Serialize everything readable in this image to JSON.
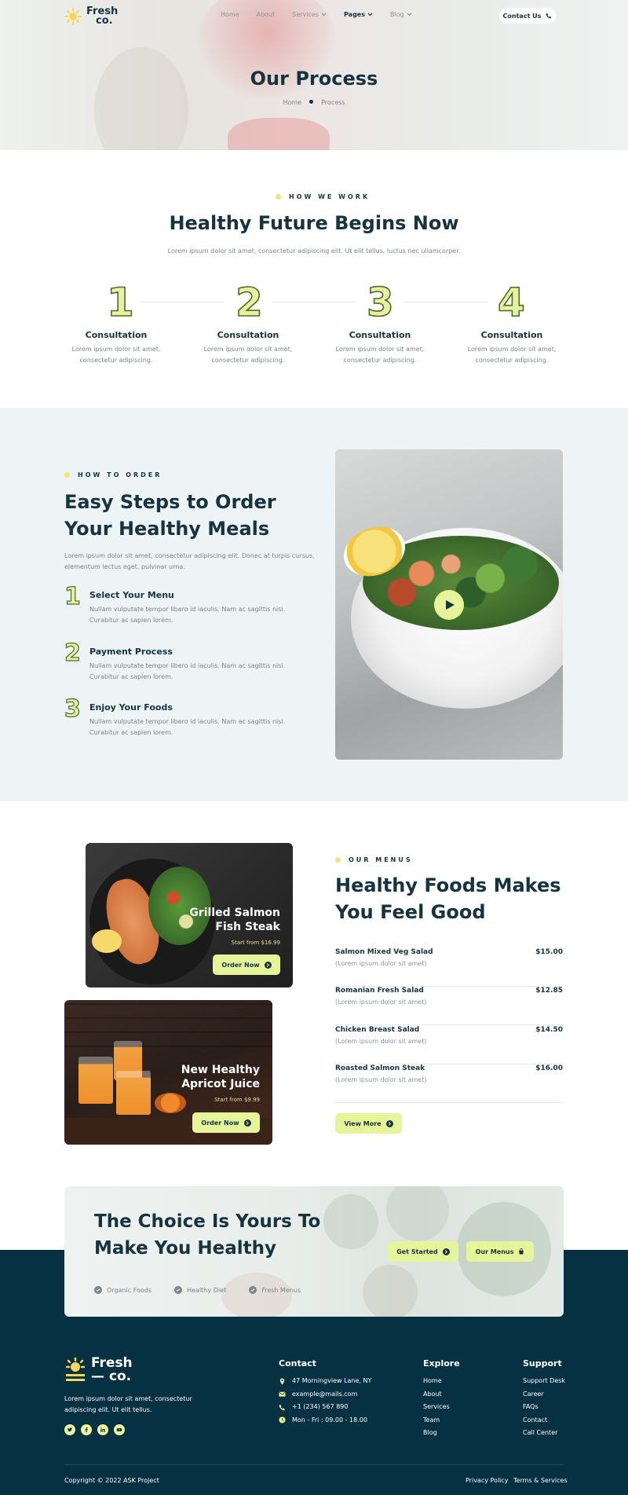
{
  "brand": {
    "name_line1": "Fresh",
    "name_line2": "co.",
    "footer_line1": "Fresh",
    "footer_line2": "— co."
  },
  "nav": {
    "home": "Home",
    "about": "About",
    "services": "Services",
    "pages": "Pages",
    "blog": "Blog",
    "contact": "Contact Us"
  },
  "hero": {
    "title": "Our Process",
    "crumb_home": "Home",
    "crumb_current": "Process"
  },
  "how": {
    "eyebrow": "HOW WE WORK",
    "title": "Healthy Future Begins Now",
    "lead": "Lorem ipsum dolor sit amet, consectetur adipiscing elit. Ut elit tellus, luctus nec ullamcorper.",
    "steps": [
      {
        "num": "1",
        "title": "Consultation",
        "line1": "Lorem ipsum dolor sit amet,",
        "line2": "consectetur adipiscing."
      },
      {
        "num": "2",
        "title": "Consultation",
        "line1": "Lorem ipsum dolor sit amet,",
        "line2": "consectetur adipiscing."
      },
      {
        "num": "3",
        "title": "Consultation",
        "line1": "Lorem ipsum dolor sit amet,",
        "line2": "consectetur adipiscing."
      },
      {
        "num": "4",
        "title": "Consultation",
        "line1": "Lorem ipsum dolor sit amet,",
        "line2": "consectetur adipiscing."
      }
    ]
  },
  "order": {
    "eyebrow": "HOW TO ORDER",
    "title_line1": "Easy Steps to Order",
    "title_line2": "Your Healthy Meals",
    "lead_line1": "Lorem ipsum dolor sit amet, consectetur adipiscing elit. Donec at turpis cursus,",
    "lead_line2": "elementum lectus eget, pulvinar urna.",
    "steps": [
      {
        "num": "1",
        "title": "Select Your Menu",
        "line1": "Nullam vulputate tempor libero id iaculis. Nam ac sagittis nisi.",
        "line2": "Curabitur ac sapien lorem."
      },
      {
        "num": "2",
        "title": "Payment Process",
        "line1": "Nullam vulputate tempor libero id iaculis. Nam ac sagittis nisi.",
        "line2": "Curabitur ac sapien lorem."
      },
      {
        "num": "3",
        "title": "Enjoy Your Foods",
        "line1": "Nullam vulputate tempor libero id iaculis. Nam ac sagittis nisi.",
        "line2": "Curabitur ac sapien lorem."
      }
    ]
  },
  "menu": {
    "eyebrow": "OUR MENUS",
    "title_line1": "Healthy Foods Makes",
    "title_line2": "You Feel Good",
    "card1": {
      "title_line1": "Grilled Salmon",
      "title_line2": "Fish Steak",
      "price": "Start from $16.99",
      "button": "Order Now"
    },
    "card2": {
      "title_line1": "New Healthy",
      "title_line2": "Apricot Juice",
      "price": "Start from $9.99",
      "button": "Order Now"
    },
    "items": [
      {
        "name": "Salmon Mixed Veg Salad",
        "price": "$15.00",
        "desc": "(Lorem ipsum dolor sit amet)"
      },
      {
        "name": "Romanian Fresh Salad",
        "price": "$12.85",
        "desc": "(Lorem ipsum dolor sit amet)"
      },
      {
        "name": "Chicken Breast Salad",
        "price": "$14.50",
        "desc": "(Lorem ipsum dolor sit amet)"
      },
      {
        "name": "Roasted Salmon Steak",
        "price": "$16.00",
        "desc": "(Lorem ipsum dolor sit amet)"
      }
    ],
    "view_more": "View More"
  },
  "cta": {
    "title_line1": "The Choice Is Yours To",
    "title_line2": "Make You Healthy",
    "checks": [
      "Organic Foods",
      "Healthy Diet",
      "Fresh Menus"
    ],
    "get_started": "Get Started",
    "our_menus": "Our Menus"
  },
  "footer": {
    "desc_line1": "Lorem ipsum dolor sit amet, consectetur",
    "desc_line2": "adipiscing elit. Ut elit tellus.",
    "contact_head": "Contact",
    "contact": {
      "address": "47 Morningview Lane, NY",
      "email": "example@mails.com",
      "phone": "+1 (234) 567 890",
      "hours": "Mon - Fri : 09.00 - 18.00"
    },
    "explore_head": "Explore",
    "explore": [
      "Home",
      "About",
      "Services",
      "Team",
      "Blog"
    ],
    "support_head": "Support",
    "support": [
      "Support Desk",
      "Career",
      "FAQs",
      "Contact",
      "Call Center"
    ],
    "copyright": "Copyright © 2022 ASK Project",
    "privacy": "Privacy Policy",
    "terms": "Terms & Services"
  },
  "colors": {
    "navy": "#053143",
    "lime": "#e6f59a",
    "text": "#163340",
    "muted": "#7b8589",
    "section_bg": "#eef3f5"
  }
}
